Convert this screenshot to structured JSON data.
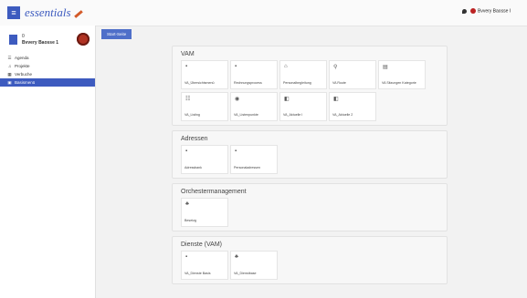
{
  "topbar": {
    "brand": "essentials",
    "user": "Bvverу Ваоssе I"
  },
  "sidebar": {
    "user_line1": "0",
    "user_line2": "Bvverу Ваоssе 1",
    "items": [
      {
        "icon": "☰",
        "label": "Agenda"
      },
      {
        "icon": "♫",
        "label": "Projekte"
      },
      {
        "icon": "▦",
        "label": "Verbuche"
      },
      {
        "icon": "▣",
        "label": "Basismenü"
      }
    ]
  },
  "tab": "Start-Seite",
  "sections": [
    {
      "title": "VAM",
      "cards": [
        {
          "icon": "▪",
          "label": "VA_Übersichtsmenü"
        },
        {
          "icon": "▪",
          "label": "Rechnungsprocess"
        },
        {
          "icon": "⌂",
          "label": "Personalbegleitung"
        },
        {
          "icon": "⚲",
          "label": "VA Route"
        },
        {
          "icon": "▤",
          "label": "VA Sitzungen Kategorie"
        },
        {
          "icon": "☷",
          "label": "VA_Listing"
        },
        {
          "icon": "◉",
          "label": "VA_Listenpunkte"
        },
        {
          "icon": "◧",
          "label": "VA_Aktuelle I"
        },
        {
          "icon": "◧",
          "label": "VA_Aktuelle 2"
        }
      ]
    },
    {
      "title": "Adressen",
      "cards": [
        {
          "icon": "▪",
          "label": "Adressbank"
        },
        {
          "icon": "▪",
          "label": "Personaladressen"
        }
      ]
    },
    {
      "title": "Orchestermanagement",
      "cards": [
        {
          "icon": "♣",
          "label": "Besetzg"
        }
      ]
    },
    {
      "title": "Dienste (VAM)",
      "cards": [
        {
          "icon": "▪",
          "label": "VA_Dienste Basis"
        },
        {
          "icon": "♣",
          "label": "VA_Dienstbase"
        }
      ]
    }
  ]
}
